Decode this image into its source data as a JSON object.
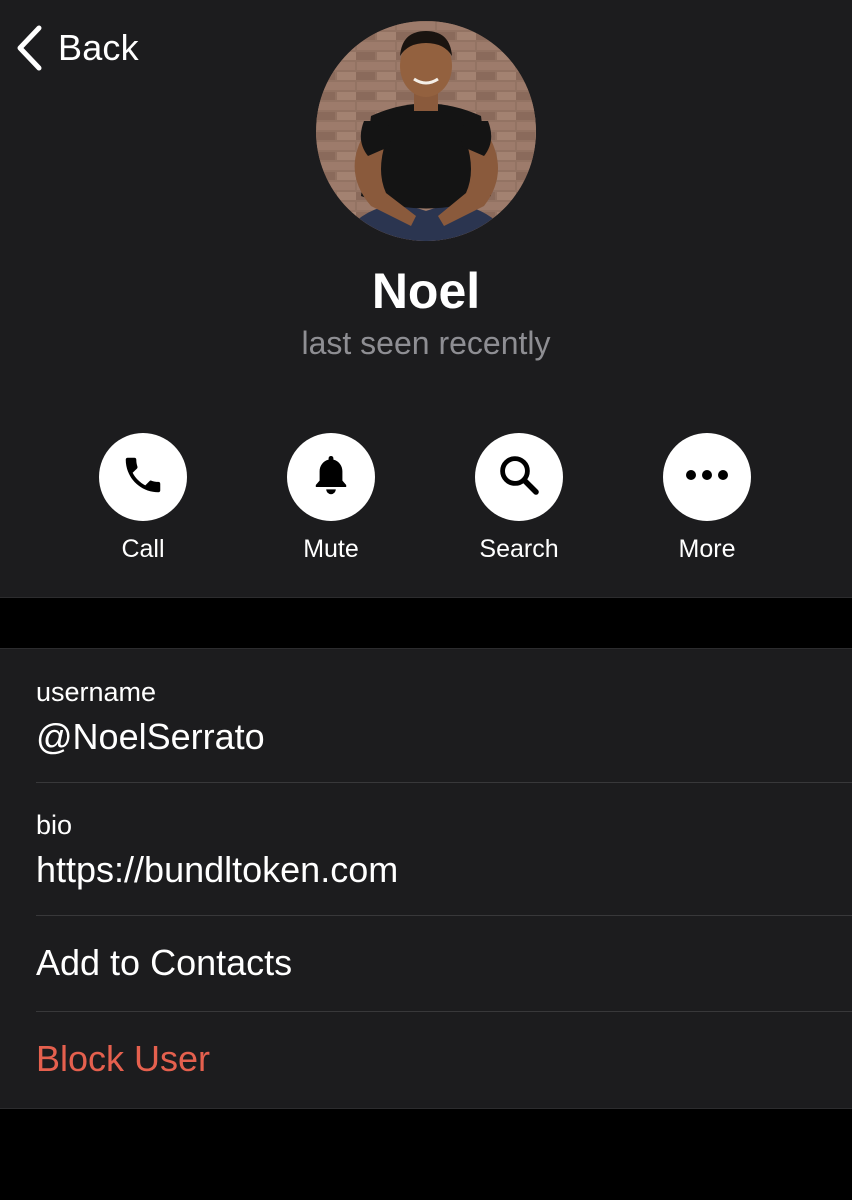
{
  "nav": {
    "back_label": "Back"
  },
  "profile": {
    "name": "Noel",
    "status": "last seen recently"
  },
  "actions": [
    {
      "label": "Call",
      "icon": "phone-icon"
    },
    {
      "label": "Mute",
      "icon": "bell-icon"
    },
    {
      "label": "Search",
      "icon": "search-icon"
    },
    {
      "label": "More",
      "icon": "more-icon"
    }
  ],
  "info": {
    "username": {
      "label": "username",
      "value": "@NoelSerrato"
    },
    "bio": {
      "label": "bio",
      "value": "https://bundltoken.com"
    },
    "add_contact_label": "Add to Contacts",
    "block_label": "Block User"
  },
  "colors": {
    "background": "#000000",
    "panel": "#1c1c1e",
    "secondary_text": "#8e8e93",
    "destructive": "#e5604e"
  }
}
